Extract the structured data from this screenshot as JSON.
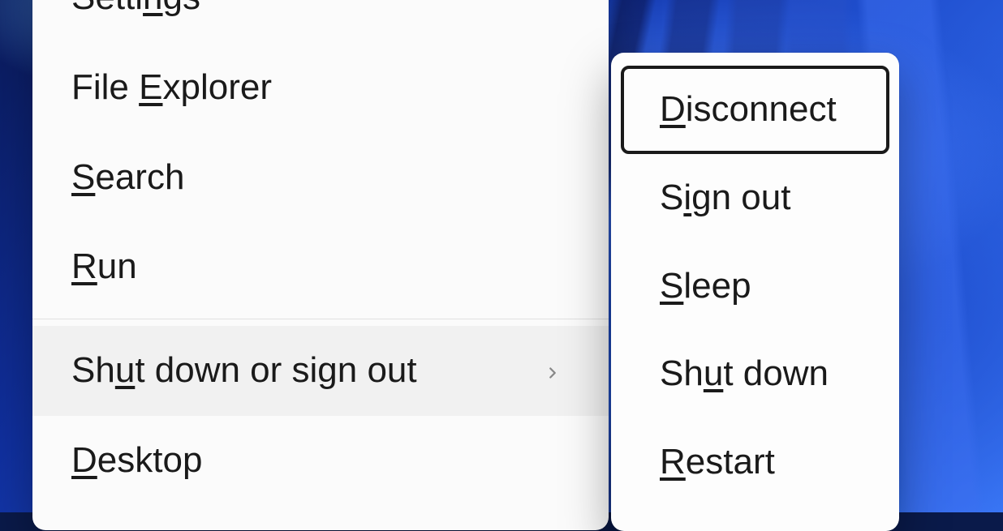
{
  "main_menu": {
    "items": [
      {
        "pre": "Setti",
        "u": "n",
        "post": "gs"
      },
      {
        "pre": "File ",
        "u": "E",
        "post": "xplorer"
      },
      {
        "pre": "",
        "u": "S",
        "post": "earch"
      },
      {
        "pre": "",
        "u": "R",
        "post": "un"
      },
      {
        "pre": "Sh",
        "u": "u",
        "post": "t down or sign out",
        "has_submenu": true,
        "hovered": true
      },
      {
        "pre": "",
        "u": "D",
        "post": "esktop"
      }
    ],
    "divider_after_index": 3
  },
  "submenu": {
    "items": [
      {
        "pre": "",
        "u": "D",
        "post": "isconnect",
        "focused": true
      },
      {
        "pre": "S",
        "u": "i",
        "post": "gn out"
      },
      {
        "pre": "",
        "u": "S",
        "post": "leep"
      },
      {
        "pre": "Sh",
        "u": "u",
        "post": "t down"
      },
      {
        "pre": "",
        "u": "R",
        "post": "estart"
      }
    ]
  }
}
